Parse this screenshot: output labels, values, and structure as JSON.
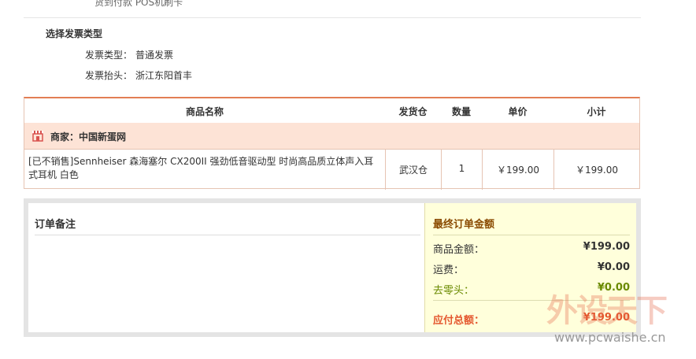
{
  "payment": {
    "method_text": "货到付款 POS机刷卡"
  },
  "invoice": {
    "section_title": "选择发票类型",
    "type_label": "发票类型：",
    "type_value": "普通发票",
    "header_label": "发票抬头：",
    "header_value": "浙江东阳首丰"
  },
  "table": {
    "headers": [
      "商品名称",
      "发货仓",
      "数量",
      "单价",
      "小计"
    ],
    "merchant_label": "商家：",
    "merchant_name": "中国新蛋网",
    "rows": [
      {
        "name": "[已不销售]Sennheiser 森海塞尔 CX200II 强劲低音驱动型 时尚高品质立体声入耳式耳机 白色",
        "warehouse": "武汉仓",
        "quantity": "1",
        "unit_price": "￥199.00",
        "subtotal": "￥199.00"
      }
    ]
  },
  "order_note": {
    "title": "订单备注"
  },
  "total": {
    "title": "最终订单金额",
    "goods_label": "商品金额：",
    "goods_value": "¥199.00",
    "shipping_label": "运费：",
    "shipping_value": "¥0.00",
    "rounding_label": "去零头：",
    "rounding_value": "¥0.00",
    "payable_label": "应付总额：",
    "payable_value": "¥199.00"
  },
  "watermark": {
    "logo_text": "外设天下",
    "url": "www.pcwaishe.cn"
  },
  "colors": {
    "accent": "#e27e54",
    "merchant_bg": "#fde3d6",
    "total_bg": "#ffffdb",
    "rounding_green": "#6a8a00",
    "payable_red": "#e4572e"
  }
}
